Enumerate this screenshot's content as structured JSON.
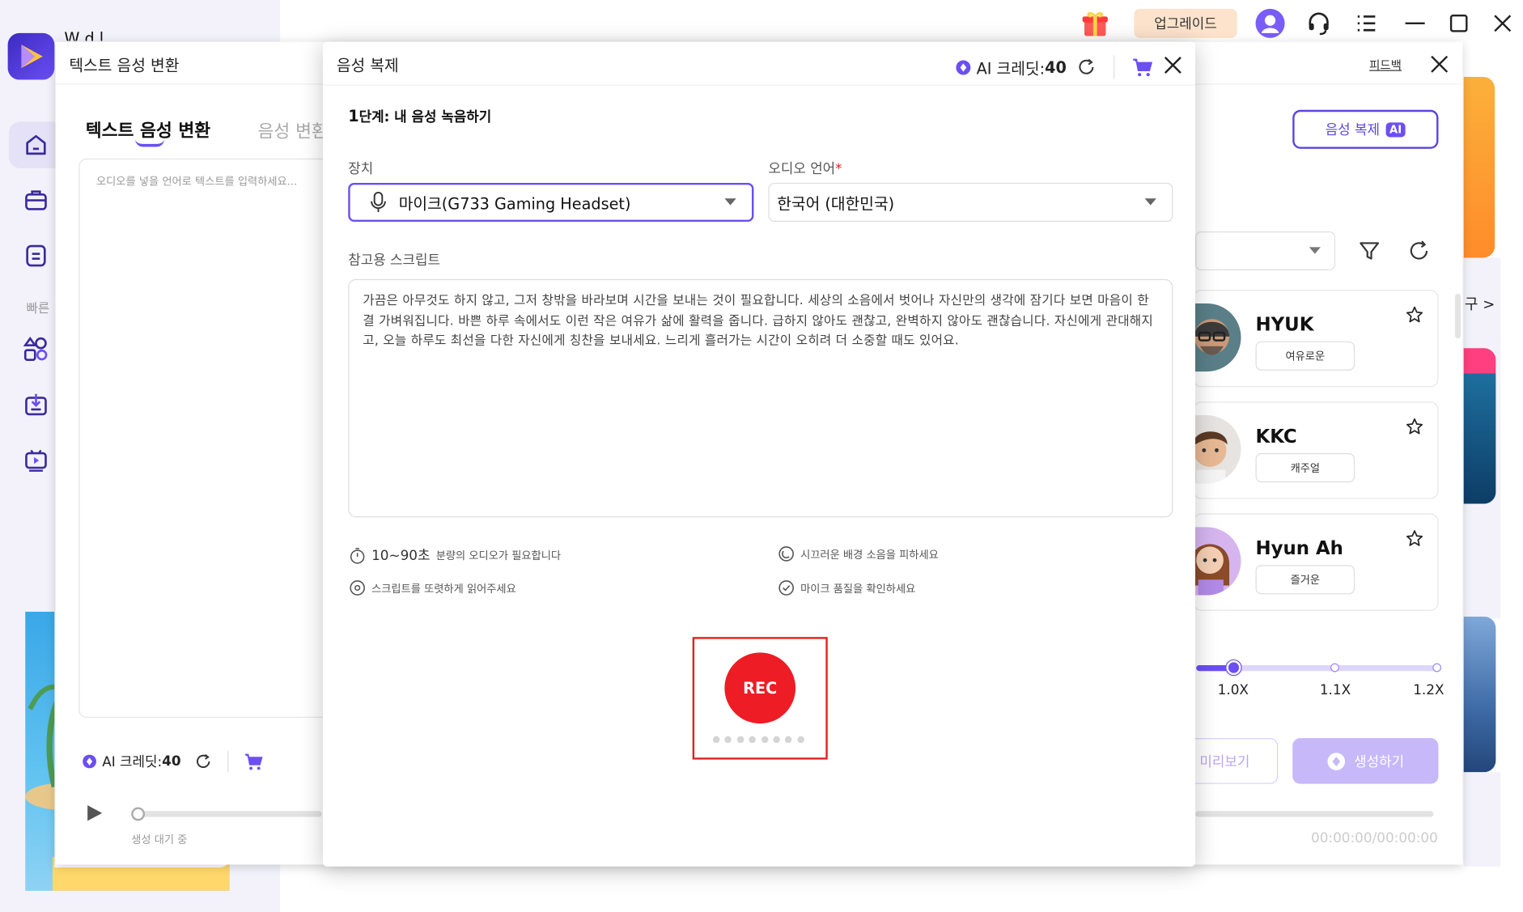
{
  "app": {
    "title_partial": "W    d   l"
  },
  "topbar": {
    "upgrade_label": "업그레이드"
  },
  "sidebar": {
    "quick_label": "빠른"
  },
  "tts_window": {
    "title": "텍스트 음성 변환",
    "tab_active": "텍스트 음성 변환",
    "tab_inactive": "음성 변환",
    "input_placeholder": "오디오를 넣을 언어로 텍스트를 입력하세요...",
    "feedback_label": "피드백",
    "voice_clone_button": "음성 복제",
    "ai_badge": "AI",
    "credits_label": "AI 크레딧:",
    "credits_value": "40",
    "status_waiting": "생성 대기 중",
    "time_display": "00:00:00/00:00:00",
    "preview_button": "미리보기",
    "generate_button": "생성하기",
    "side_more": "구 >",
    "voices": [
      {
        "name": "HYUK",
        "tag": "여유로운"
      },
      {
        "name": "KKC",
        "tag": "캐주얼"
      },
      {
        "name": "Hyun Ah",
        "tag": "즐거운"
      }
    ],
    "speed": {
      "labels": [
        "1.0X",
        "1.1X",
        "1.2X"
      ],
      "current": "1.0X"
    }
  },
  "clone_modal": {
    "title": "음성 복제",
    "credits_label": "AI 크레딧:",
    "credits_value": "40",
    "step_number": "1",
    "step_text": "단계: 내 음성 녹음하기",
    "device_label": "장치",
    "device_value": "마이크(G733 Gaming Headset)",
    "language_label": "오디오 언어",
    "required_mark": "*",
    "language_value": "한국어 (대한민국)",
    "script_label": "참고용 스크립트",
    "script_text": "가끔은 아무것도 하지 않고, 그저 창밖을 바라보며 시간을 보내는 것이 필요합니다. 세상의 소음에서 벗어나 자신만의 생각에 잠기다 보면 마음이 한결 가벼워집니다. 바쁜 하루 속에서도 이런 작은 여유가 삶에 활력을 줍니다. 급하지 않아도 괜찮고, 완벽하지 않아도 괜찮습니다. 자신에게 관대해지고, 오늘 하루도 최선을 다한 자신에게 칭찬을 보내세요. 느리게 흘러가는 시간이 오히려 더 소중할 때도 있어요.",
    "tip_duration_num": "10~90초",
    "tip_duration_rest": "분량의 오디오가 필요합니다",
    "tip_noise": "시끄러운 배경 소음을 피하세요",
    "tip_read": "스크립트를 또렷하게 읽어주세요",
    "tip_mic": "마이크 품질을 확인하세요",
    "rec_label": "REC"
  },
  "colors": {
    "accent": "#6b4ef5",
    "rec": "#ee1c25",
    "upgrade_bg": "#fde3cc"
  },
  "icons": [
    "logo-icon",
    "gift-icon",
    "account-icon",
    "support-icon",
    "menu-icon",
    "minimize-icon",
    "maximize-icon",
    "close-icon",
    "home-icon",
    "toolbox-icon",
    "document-icon",
    "shapes-icon",
    "download-icon",
    "video-icon",
    "credit-gem-icon",
    "refresh-icon",
    "cart-icon",
    "mic-icon",
    "dropdown-icon",
    "timer-icon",
    "noise-icon",
    "eye-icon",
    "check-circle-icon",
    "filter-icon",
    "star-icon",
    "play-icon"
  ]
}
